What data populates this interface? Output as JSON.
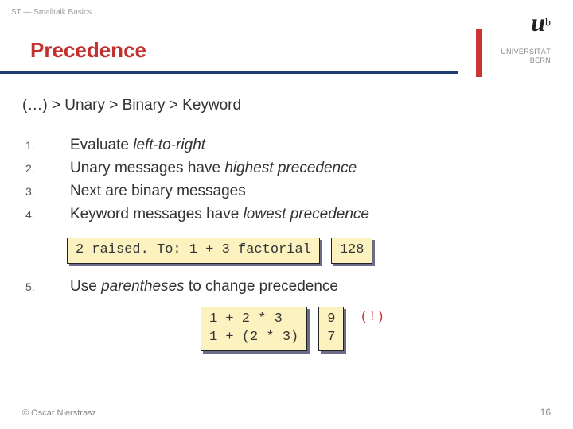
{
  "breadcrumb": "ST — Smalltalk Basics",
  "title": "Precedence",
  "logo": {
    "u": "u",
    "b": "b",
    "line1": "UNIVERSITÄT",
    "line2": "BERN"
  },
  "rule": "(…) > Unary > Binary > Keyword",
  "items": [
    {
      "num": "1.",
      "pre": "Evaluate ",
      "em": "left-to-right",
      "post": ""
    },
    {
      "num": "2.",
      "pre": "Unary messages have ",
      "em": "highest precedence",
      "post": ""
    },
    {
      "num": "3.",
      "pre": "Next are binary messages",
      "em": "",
      "post": ""
    },
    {
      "num": "4.",
      "pre": "Keyword messages have ",
      "em": "lowest precedence",
      "post": ""
    }
  ],
  "code1": "2 raised. To: 1 + 3 factorial",
  "code1result": "128",
  "item5": {
    "num": "5.",
    "pre": "Use ",
    "em": "parentheses",
    "post": " to change precedence"
  },
  "code2": "1 + 2 * 3\n1 + (2 * 3)",
  "code2result": "9\n7",
  "bang": "(!)",
  "footer_left": "© Oscar Nierstrasz",
  "footer_right": "16"
}
